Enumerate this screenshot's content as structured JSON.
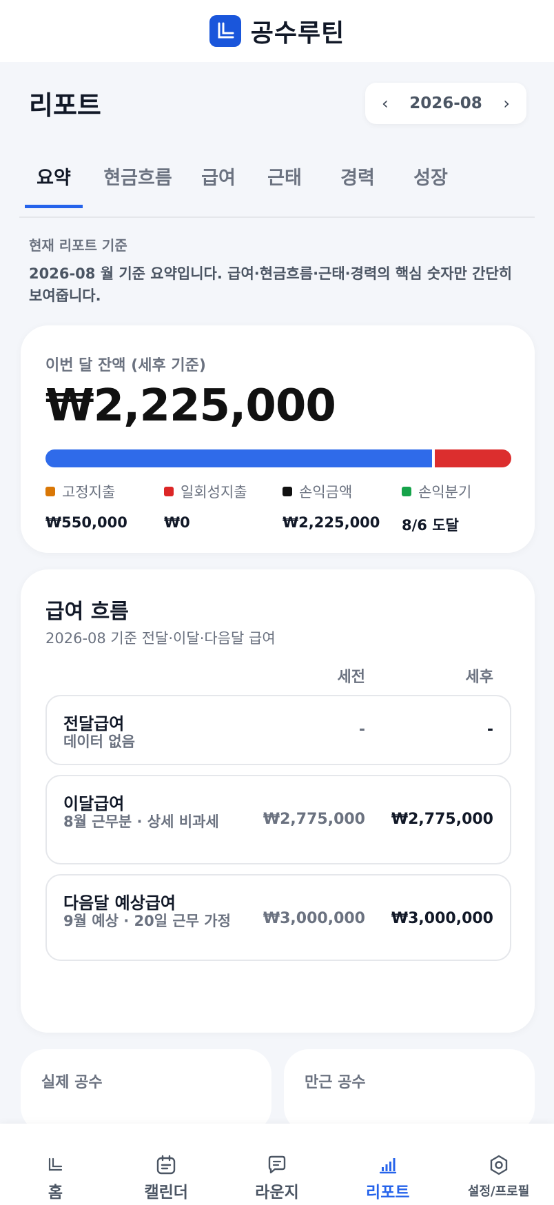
{
  "app": {
    "title": "공수루틴",
    "logo_icon": "app-logo-icon",
    "brand_color": "#1a56db"
  },
  "page": {
    "title": "리포트"
  },
  "month_picker": {
    "prev": "‹",
    "value": "2026-08",
    "next": "›"
  },
  "tabs": [
    {
      "label": "요약",
      "active": true
    },
    {
      "label": "현금흐름",
      "active": false
    },
    {
      "label": "급여",
      "active": false
    },
    {
      "label": "근태",
      "active": false
    },
    {
      "label": "경력",
      "active": false
    },
    {
      "label": "성장",
      "active": false
    }
  ],
  "summary": {
    "label": "현재 리포트 기준",
    "text": "2026-08 월 기준 요약입니다. 급여·현금흐름·근태·경력의 핵심 숫자만 간단히 보여줍니다."
  },
  "balance": {
    "label": "이번 달 잔액 (세후 기준)",
    "amount": "₩2,225,000",
    "bar": [
      {
        "share": 0.835,
        "color": "#2f6bea"
      },
      {
        "share": 0.165,
        "color": "#dc2e2e"
      }
    ],
    "legend": [
      {
        "label": "고정지출",
        "value": "₩550,000",
        "color": "#d97706"
      },
      {
        "label": "일회성지출",
        "value": "₩0",
        "color": "#dc2626"
      },
      {
        "label": "손익금액",
        "value": "₩2,225,000",
        "color": "#111111"
      },
      {
        "label": "손익분기",
        "value": "8/6 도달",
        "color": "#16a34a"
      }
    ]
  },
  "salary": {
    "title": "급여 흐름",
    "subtitle": "2026-08 기준 전달·이달·다음달 급여",
    "col_pre": "세전",
    "col_post": "세후",
    "rows": [
      {
        "title": "전달급여",
        "sub": "데이터 없음",
        "pre": "-",
        "post": "-"
      },
      {
        "title": "이달급여",
        "sub": "8월 근무분 · 상세 비과세",
        "pre": "₩2,775,000",
        "post": "₩2,775,000"
      },
      {
        "title": "다음달 예상급여",
        "sub": "9월 예상 · 20일 근무 가정",
        "pre": "₩3,000,000",
        "post": "₩3,000,000"
      }
    ]
  },
  "mini_cards": [
    {
      "label": "실제 공수"
    },
    {
      "label": "만근 공수"
    }
  ],
  "nav": [
    {
      "label": "홈",
      "icon": "home-icon",
      "active": false
    },
    {
      "label": "캘린더",
      "icon": "calendar-icon",
      "active": false
    },
    {
      "label": "라운지",
      "icon": "chat-icon",
      "active": false
    },
    {
      "label": "리포트",
      "icon": "bar-chart-icon",
      "active": true
    },
    {
      "label": "설정/프로필",
      "icon": "settings-icon",
      "active": false
    }
  ],
  "accent_color": "#2563eb"
}
